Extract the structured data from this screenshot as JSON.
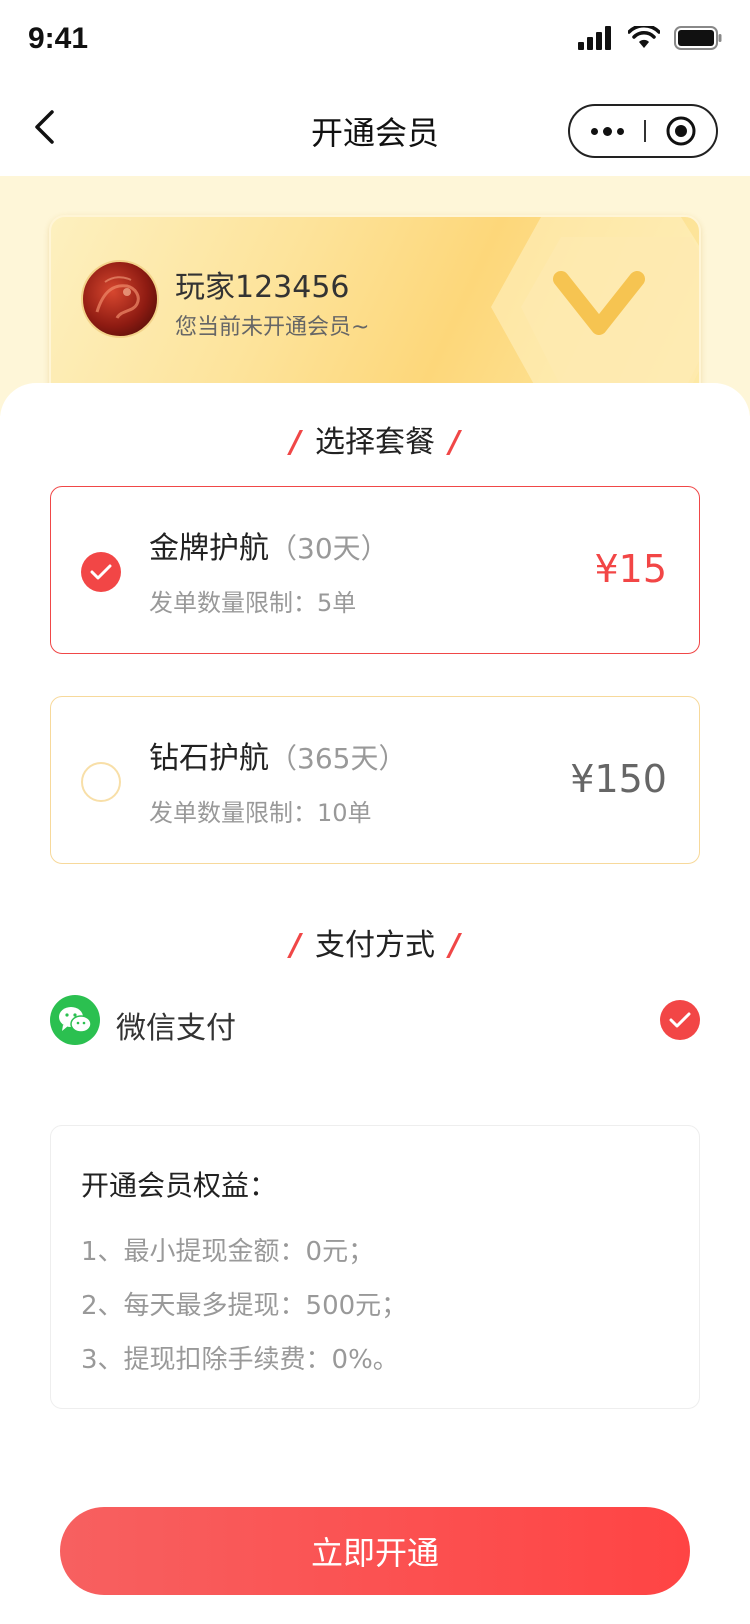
{
  "status_bar": {
    "time": "9:41"
  },
  "nav": {
    "title": "开通会员"
  },
  "member": {
    "username": "玩家123456",
    "status": "您当前未开通会员~"
  },
  "plans_section": {
    "title": "选择套餐"
  },
  "plans": [
    {
      "name": "金牌护航",
      "duration": "（30天）",
      "limit": "发单数量限制：5单",
      "price": "¥15",
      "selected": true
    },
    {
      "name": "钻石护航",
      "duration": "（365天）",
      "limit": "发单数量限制：10单",
      "price": "¥150",
      "selected": false
    }
  ],
  "payment_section": {
    "title": "支付方式"
  },
  "payment": {
    "method": "微信支付",
    "selected": true
  },
  "benefits": {
    "title": "开通会员权益：",
    "items": [
      "1、最小提现金额：0元；",
      "2、每天最多提现：500元；",
      "3、提现扣除手续费：0%。"
    ]
  },
  "cta": {
    "label": "立即开通"
  },
  "colors": {
    "accent": "#f24646",
    "gold": "#fdd77a",
    "wechat": "#2bc050"
  }
}
